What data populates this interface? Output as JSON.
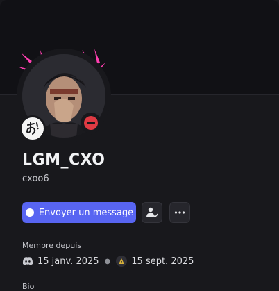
{
  "profile": {
    "display_name": "LGM_CXO",
    "username": "cxoo6",
    "status": "dnd",
    "status_color": "#e03a43"
  },
  "actions": {
    "message_label": "Envoyer un message",
    "friend_icon": "add-friend-icon",
    "more_icon": "more-options-icon"
  },
  "membership": {
    "label": "Membre depuis",
    "discord_date": "15 janv. 2025",
    "server_date": "15 sept. 2025",
    "discord_icon": "discord-logo-icon",
    "server_icon": "server-icon"
  },
  "bio": {
    "label": "Bio"
  },
  "colors": {
    "background": "#18181c",
    "banner": "#111115",
    "accent": "#5865f2",
    "decoration": "#ff3fb0"
  }
}
